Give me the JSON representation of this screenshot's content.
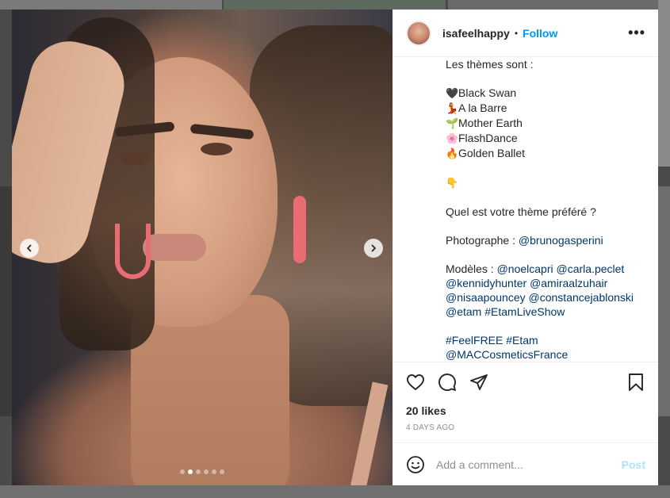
{
  "post": {
    "username": "isafeelhappy",
    "separator": "•",
    "follow_label": "Follow",
    "more_label": "•••"
  },
  "carousel": {
    "slide_count": 6,
    "active_index": 1
  },
  "caption": {
    "lines": [
      {
        "text": "Les thèmes sont :"
      },
      {
        "text": ""
      },
      {
        "emoji": "🖤",
        "text": "Black Swan"
      },
      {
        "emoji": "💃",
        "text": "A la Barre"
      },
      {
        "emoji": "🌱",
        "text": "Mother Earth"
      },
      {
        "emoji": "🌸",
        "text": "FlashDance"
      },
      {
        "emoji": "🔥",
        "text": "Golden Ballet"
      },
      {
        "text": ""
      },
      {
        "emoji": "👇",
        "text": ""
      },
      {
        "text": ""
      },
      {
        "text": "Quel est votre thème préféré ?"
      },
      {
        "text": ""
      },
      {
        "text": "Photographe : ",
        "mentions": [
          "@brunogasperini"
        ]
      },
      {
        "text": ""
      },
      {
        "text": "Modèles : ",
        "mentions": [
          "@noelcapri",
          "@carla.peclet"
        ]
      },
      {
        "text": "",
        "mentions": [
          "@kennidyhunter",
          "@amiraalzuhair"
        ]
      },
      {
        "text": "",
        "mentions": [
          "@nisaapouncey",
          "@constancejablonski"
        ]
      },
      {
        "text": "",
        "mentions": [
          "@etam",
          "#EtamLiveShow"
        ]
      },
      {
        "text": ""
      },
      {
        "text": "",
        "mentions": [
          "#FeelFREE",
          "#Etam"
        ]
      },
      {
        "text": "",
        "mentions": [
          "@MACCosmeticsFrance"
        ]
      }
    ]
  },
  "engagement": {
    "likes": "20 likes",
    "date": "4 DAYS AGO"
  },
  "comment": {
    "placeholder": "Add a comment...",
    "post_label": "Post"
  },
  "icons": {
    "like": "heart-icon",
    "comment": "comment-bubble-icon",
    "share": "paper-plane-icon",
    "save": "bookmark-icon",
    "emoji": "smiley-icon",
    "prev": "chevron-left-icon",
    "next": "chevron-right-icon"
  },
  "colors": {
    "follow": "#0095f6",
    "mention": "#00376b",
    "post_disabled": "#b2dffc"
  }
}
